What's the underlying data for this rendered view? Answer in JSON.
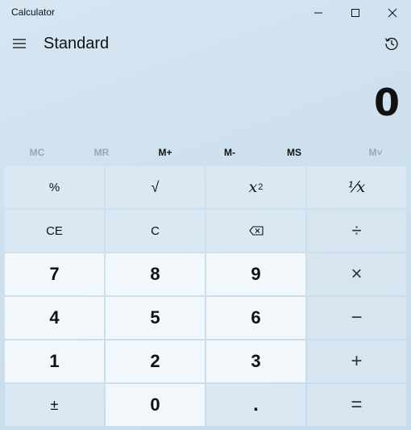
{
  "window": {
    "title": "Calculator"
  },
  "header": {
    "mode_title": "Standard"
  },
  "display": {
    "value": "0"
  },
  "memory": [
    {
      "label": "MC",
      "enabled": false
    },
    {
      "label": "MR",
      "enabled": false
    },
    {
      "label": "M+",
      "enabled": true
    },
    {
      "label": "M-",
      "enabled": true
    },
    {
      "label": "MS",
      "enabled": true
    },
    {
      "label": "M˅",
      "enabled": false
    }
  ],
  "keys": {
    "percent": "%",
    "sqrt": "√",
    "square_base": "x",
    "square_exp": "2",
    "reciprocal": "⅟x",
    "ce": "CE",
    "c": "C",
    "divide": "÷",
    "multiply": "×",
    "subtract": "−",
    "add": "+",
    "equals": "=",
    "negate": "±",
    "decimal": ".",
    "d0": "0",
    "d1": "1",
    "d2": "2",
    "d3": "3",
    "d4": "4",
    "d5": "5",
    "d6": "6",
    "d7": "7",
    "d8": "8",
    "d9": "9"
  },
  "icons": {
    "menu": "hamburger-menu-icon",
    "history": "history-icon",
    "backspace": "backspace-icon",
    "minimize": "minimize-icon",
    "maximize": "maximize-icon",
    "close": "close-icon"
  }
}
